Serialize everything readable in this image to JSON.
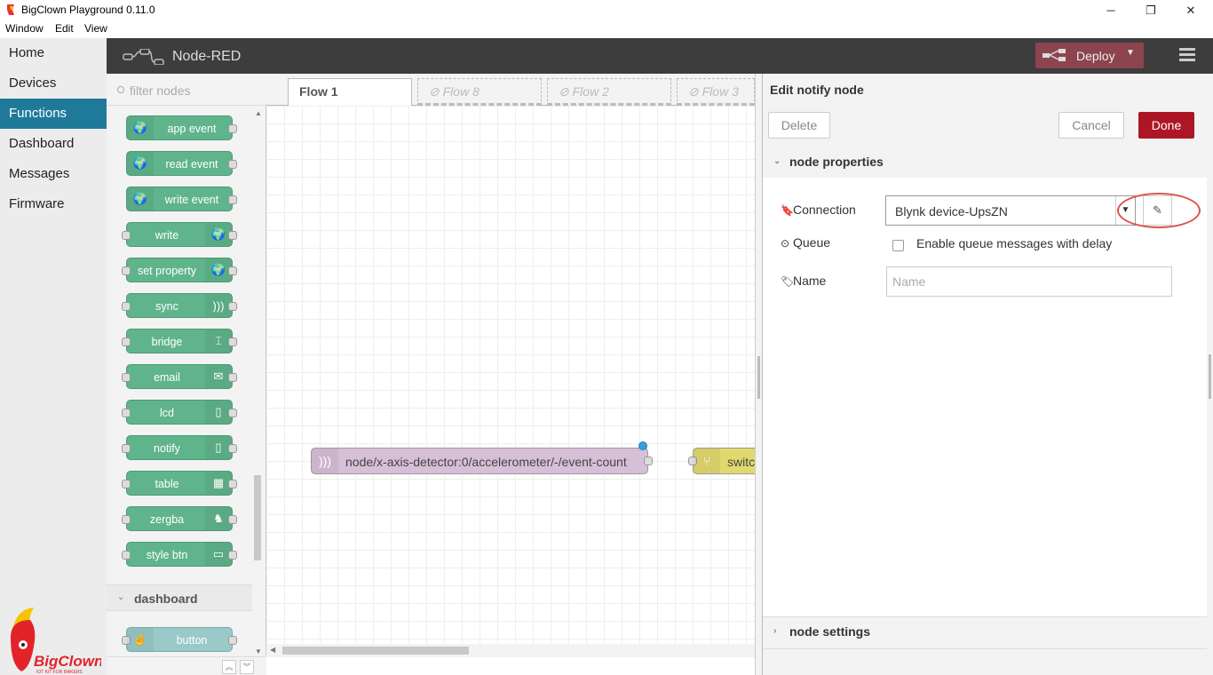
{
  "window": {
    "title": "BigClown Playground 0.11.0",
    "minimize": "─",
    "restore": "❐",
    "close": "✕"
  },
  "menu": [
    "Window",
    "Edit",
    "View"
  ],
  "nav": {
    "items": [
      {
        "label": "Home",
        "active": false
      },
      {
        "label": "Devices",
        "active": false
      },
      {
        "label": "Functions",
        "active": true
      },
      {
        "label": "Dashboard",
        "active": false
      },
      {
        "label": "Messages",
        "active": false
      },
      {
        "label": "Firmware",
        "active": false
      }
    ],
    "logo_text": "BigClown",
    "logo_tagline": "IOT KIT FOR MAKERS"
  },
  "header": {
    "brand": "Node-RED",
    "deploy_label": "Deploy"
  },
  "palette": {
    "filter_placeholder": "filter nodes",
    "nodes": [
      {
        "label": "app event",
        "icon": "globe-icon",
        "glyph": "🌍",
        "side": "left"
      },
      {
        "label": "read event",
        "icon": "globe-icon",
        "glyph": "🌍",
        "side": "left"
      },
      {
        "label": "write event",
        "icon": "globe-icon",
        "glyph": "🌍",
        "side": "left"
      },
      {
        "label": "write",
        "icon": "globe-icon",
        "glyph": "🌍",
        "side": "right"
      },
      {
        "label": "set property",
        "icon": "globe-icon",
        "glyph": "🌍",
        "side": "right"
      },
      {
        "label": "sync",
        "icon": "wireless-icon",
        "glyph": ")))",
        "side": "right"
      },
      {
        "label": "bridge",
        "icon": "bridge-icon",
        "glyph": "⌶",
        "side": "right"
      },
      {
        "label": "email",
        "icon": "envelope-icon",
        "glyph": "✉",
        "side": "right"
      },
      {
        "label": "lcd",
        "icon": "device-icon",
        "glyph": "▯",
        "side": "right"
      },
      {
        "label": "notify",
        "icon": "phone-notify-icon",
        "glyph": "▯",
        "side": "right"
      },
      {
        "label": "table",
        "icon": "table-icon",
        "glyph": "▦",
        "side": "right"
      },
      {
        "label": "zergba",
        "icon": "horse-icon",
        "glyph": "♞",
        "side": "right"
      },
      {
        "label": "style btn",
        "icon": "toggle-icon",
        "glyph": "▭",
        "side": "right"
      }
    ],
    "category": "dashboard",
    "dash_node": {
      "label": "button",
      "icon": "hand-icon",
      "glyph": "☝"
    }
  },
  "tabs": [
    {
      "label": "Flow 1",
      "state": "active"
    },
    {
      "label": "Flow 8",
      "state": "disabled"
    },
    {
      "label": "Flow 2",
      "state": "disabled"
    },
    {
      "label": "Flow 3",
      "state": "disabled"
    }
  ],
  "flow": {
    "node1": {
      "label": "node/x-axis-detector:0/accelerometer/-/event-count",
      "color": "#d7bfd7"
    },
    "node2": {
      "label": "switch",
      "color": "#e2d96e"
    }
  },
  "editor": {
    "title": "Edit notify node",
    "delete_label": "Delete",
    "cancel_label": "Cancel",
    "done_label": "Done",
    "section_properties": "node properties",
    "section_settings": "node settings",
    "connection_label": "Connection",
    "connection_value": "Blynk device-UpsZN",
    "queue_label": "Queue",
    "queue_text": "Enable queue messages with delay",
    "name_label": "Name",
    "name_placeholder": "Name"
  },
  "colors": {
    "nav_active": "#1f7a9a",
    "done": "#ad1625",
    "deploy": "#8c444f",
    "palette_node": "#5fb48c",
    "highlight_ring": "#d9534f"
  }
}
